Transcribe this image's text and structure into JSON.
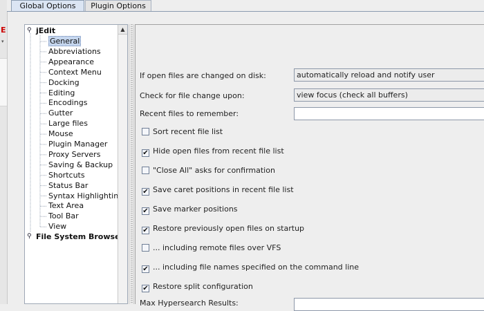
{
  "tabs": [
    {
      "label": "Global Options",
      "active": true
    },
    {
      "label": "Plugin Options",
      "active": false
    }
  ],
  "left_edge": {
    "letter": "E",
    "mark": "▾"
  },
  "tree": {
    "root": "jEdit",
    "children": [
      "General",
      "Abbreviations",
      "Appearance",
      "Context Menu",
      "Docking",
      "Editing",
      "Encodings",
      "Gutter",
      "Large files",
      "Mouse",
      "Plugin Manager",
      "Proxy Servers",
      "Saving & Backup",
      "Shortcuts",
      "Status Bar",
      "Syntax Highlighting",
      "Text Area",
      "Tool Bar",
      "View"
    ],
    "selected": "General",
    "second_root": "File System Browser",
    "expander_icon": "tree-expander-icon",
    "scroll_up_glyph": "▲"
  },
  "options": {
    "fields": [
      {
        "label": "If open files are changed on disk:",
        "value": "automatically reload and notify user",
        "kind": "combo"
      },
      {
        "label": "Check for file change upon:",
        "value": "view focus (check all buffers)",
        "kind": "combo"
      },
      {
        "label": "Recent files to remember:",
        "value": "",
        "kind": "text"
      }
    ],
    "checkboxes": [
      {
        "label": "Sort recent file list",
        "checked": false
      },
      {
        "label": "Hide open files from recent file list",
        "checked": true
      },
      {
        "label": "\"Close All\" asks for confirmation",
        "checked": false
      },
      {
        "label": "Save caret positions in recent file list",
        "checked": true
      },
      {
        "label": "Save marker positions",
        "checked": true
      },
      {
        "label": "Restore previously open files on startup",
        "checked": true
      },
      {
        "label": "... including remote files over VFS",
        "checked": false
      },
      {
        "label": "... including file names specified on the command line",
        "checked": true
      },
      {
        "label": "Restore split configuration",
        "checked": true
      }
    ],
    "bottom_label": "Max Hypersearch Results:",
    "check_glyph": "✔"
  }
}
